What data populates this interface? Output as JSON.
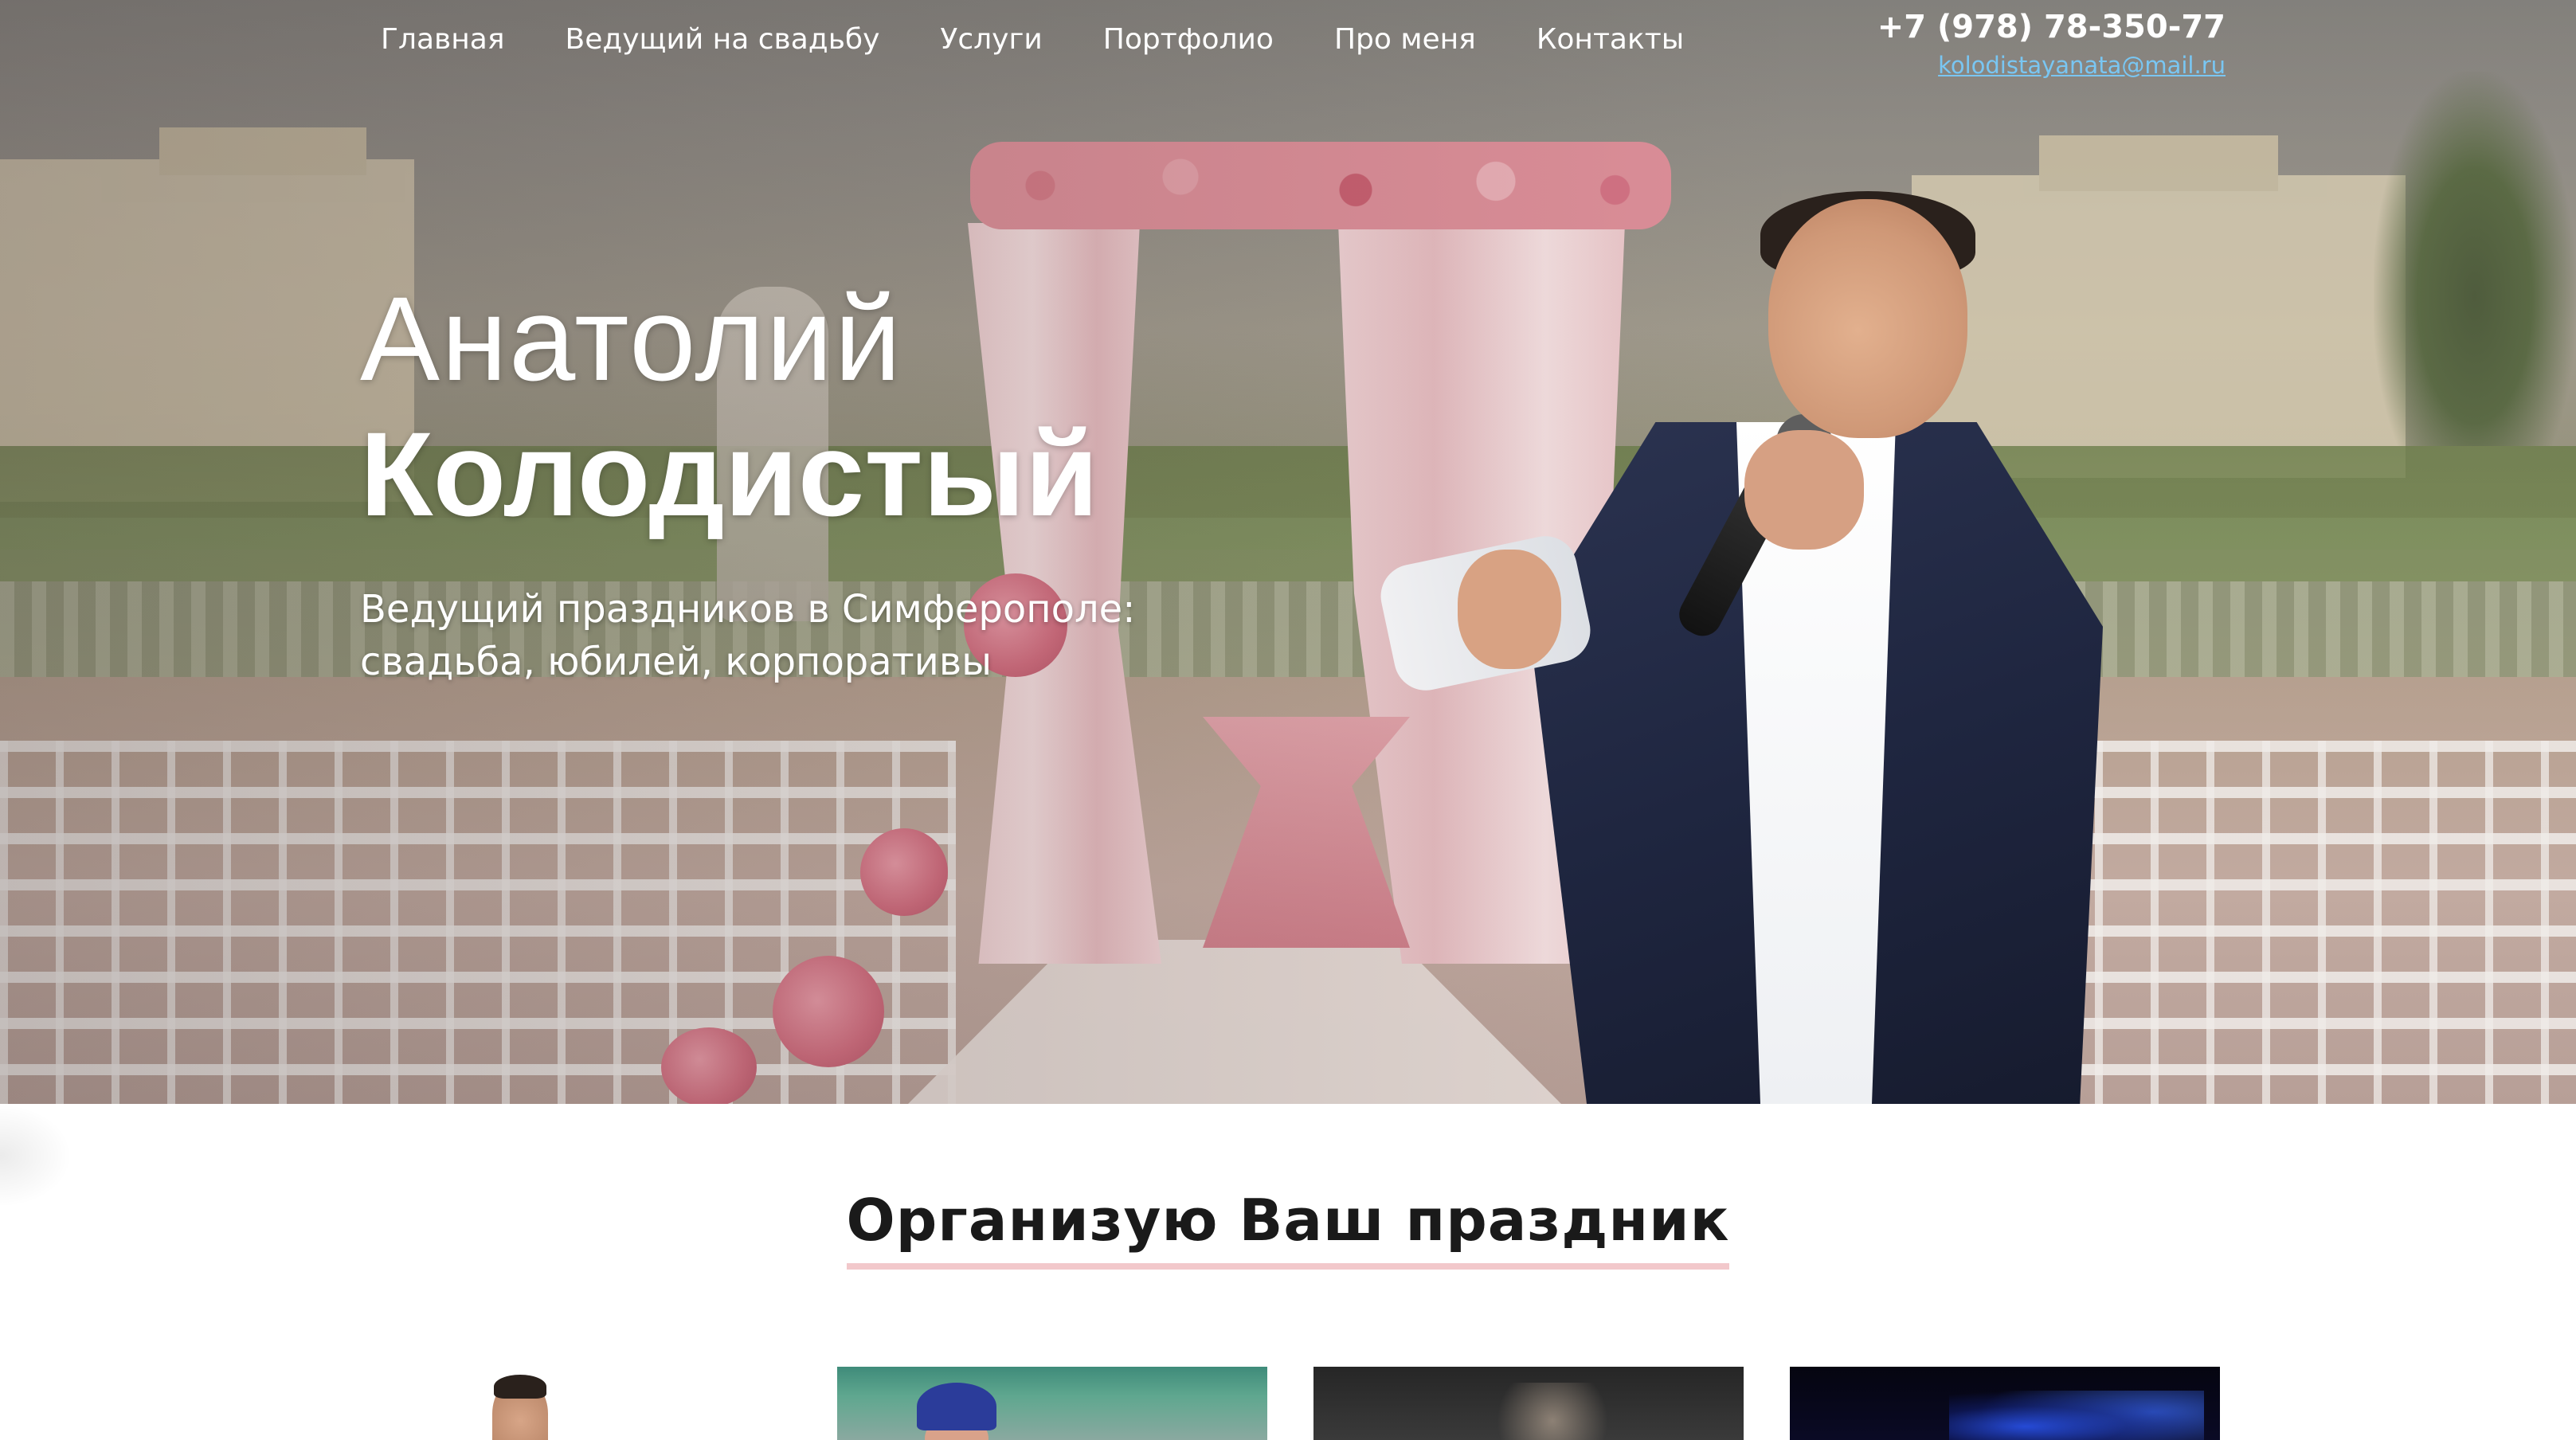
{
  "nav": {
    "items": [
      {
        "label": "Главная"
      },
      {
        "label": "Ведущий на свадьбу"
      },
      {
        "label": "Услуги"
      },
      {
        "label": "Портфолио"
      },
      {
        "label": "Про меня"
      },
      {
        "label": "Контакты"
      }
    ]
  },
  "contacts": {
    "phone": "+7 (978) 78-350-77",
    "email": "kolodistayanata@mail.ru"
  },
  "hero": {
    "first_name": "Анатолий",
    "last_name": "Колодистый",
    "subtitle_line1": "Ведущий праздников в Симферополе:",
    "subtitle_line2": "свадьба, юбилей, корпоративы",
    "background_image": "wedding-ceremony-arch-photo",
    "host_photo": "host-with-microphone-photo"
  },
  "section": {
    "title": "Организую Ваш праздник",
    "underline_color": "#f2c8cb",
    "cards": [
      {
        "image": "host-portrait-photo"
      },
      {
        "image": "clown-performer-photo"
      },
      {
        "image": "stage-performer-photo"
      },
      {
        "image": "concert-lights-photo"
      }
    ]
  },
  "colors": {
    "link_color": "#79c6f2",
    "nav_text": "#ffffff",
    "title_text": "#1a1a1a"
  }
}
